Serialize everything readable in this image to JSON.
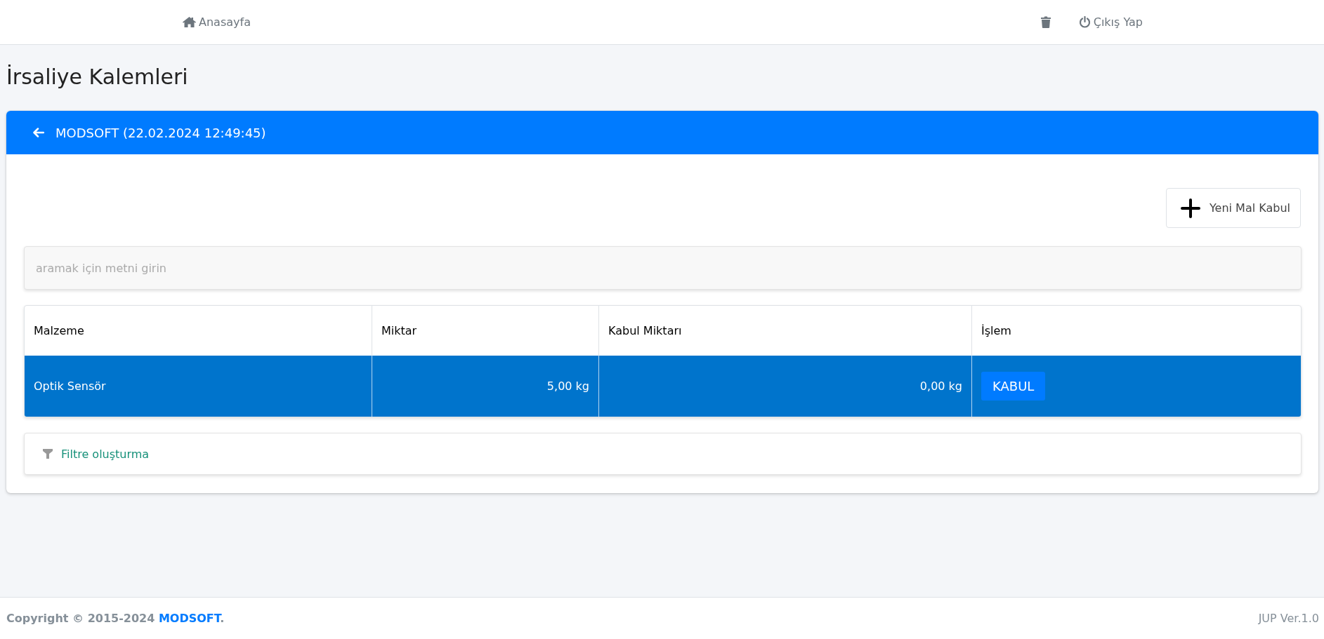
{
  "navbar": {
    "home_link": "Anasayfa",
    "logout_link": "Çıkış Yap"
  },
  "page_title": "İrsaliye Kalemleri",
  "card": {
    "header_title": "MODSOFT (22.02.2024 12:49:45)",
    "new_button": "Yeni Mal Kabul",
    "search": {
      "placeholder": "aramak için metni girin"
    },
    "table": {
      "columns": [
        "Malzeme",
        "Miktar",
        "Kabul Miktarı",
        "İşlem"
      ],
      "rows": [
        {
          "selected": true,
          "cells": [
            "Optik Sensör",
            "5,00 kg",
            "0,00 kg"
          ],
          "action": "KABUL"
        }
      ]
    },
    "filter_link": "Filtre oluşturma"
  },
  "footer": {
    "copyright": {
      "prefix": "Copyright © 2015-2024 ",
      "link": "MODSOFT",
      "suffix": "."
    },
    "version": "JUP Ver.1.0"
  }
}
